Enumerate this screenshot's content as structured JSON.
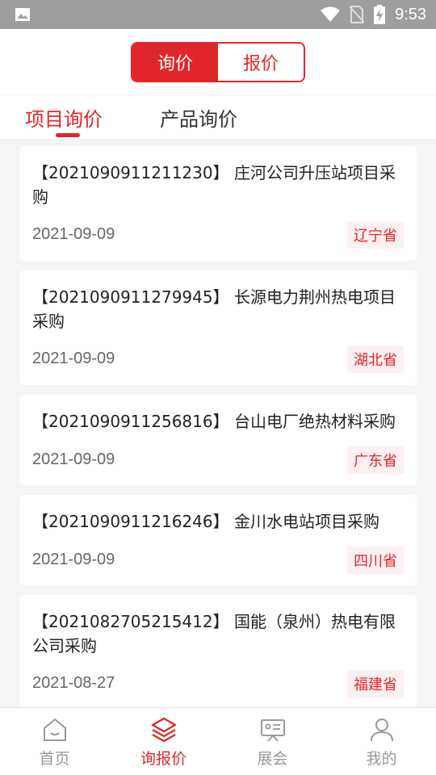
{
  "status": {
    "time": "9:53"
  },
  "segment": {
    "left": "询价",
    "right": "报价"
  },
  "tabs": [
    {
      "label": "项目询价"
    },
    {
      "label": "产品询价"
    }
  ],
  "cards": [
    {
      "title": "【2021090911211230】 庄河公司升压站项目采购",
      "date": "2021-09-09",
      "province": "辽宁省"
    },
    {
      "title": "【2021090911279945】 长源电力荆州热电项目采购",
      "date": "2021-09-09",
      "province": "湖北省"
    },
    {
      "title": "【2021090911256816】 台山电厂绝热材料采购",
      "date": "2021-09-09",
      "province": "广东省"
    },
    {
      "title": "【2021090911216246】 金川水电站项目采购",
      "date": "2021-09-09",
      "province": "四川省"
    },
    {
      "title": "【2021082705215412】 国能（泉州）热电有限公司采购",
      "date": "2021-08-27",
      "province": "福建省"
    }
  ],
  "nav": [
    {
      "label": "首页",
      "icon": "home-icon"
    },
    {
      "label": "询报价",
      "icon": "layers-icon"
    },
    {
      "label": "展会",
      "icon": "exhibition-icon"
    },
    {
      "label": "我的",
      "icon": "user-icon"
    }
  ],
  "colors": {
    "accent": "#e0262b"
  }
}
